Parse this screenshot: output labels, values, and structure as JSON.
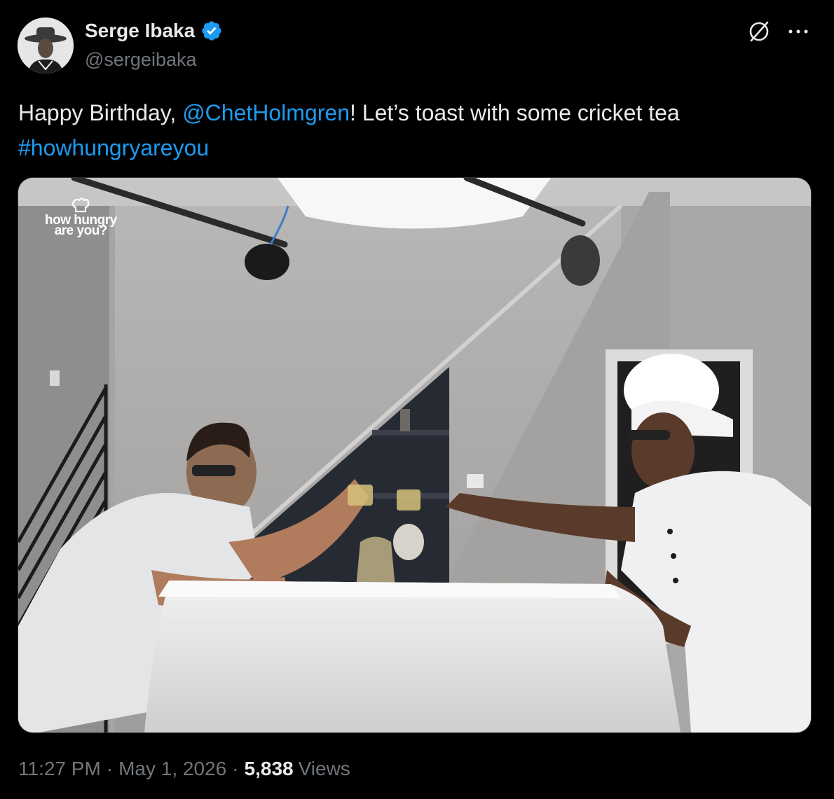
{
  "author": {
    "display_name": "Serge Ibaka",
    "handle": "@sergeibaka",
    "verified": true,
    "verified_color": "#1d9bf0"
  },
  "icons": {
    "avatar": "avatar-photo",
    "verified": "verified-badge-icon",
    "grok": "grok-icon",
    "more": "more-options-icon"
  },
  "tweet": {
    "text_before": "Happy Birthday, ",
    "mention": "@ChetHolmgren",
    "text_after": "! Let’s toast with some cricket tea",
    "hashtag": "#howhungryareyou"
  },
  "media": {
    "watermark_line1": "how hungry",
    "watermark_line2": "are you?"
  },
  "meta": {
    "time": "11:27 PM",
    "date": "May 1, 2026",
    "separator": "·",
    "views_count": "5,838",
    "views_label": "Views"
  },
  "colors": {
    "background": "#000000",
    "text": "#e7e9ea",
    "secondary": "#71767b",
    "link": "#1d9bf0"
  }
}
